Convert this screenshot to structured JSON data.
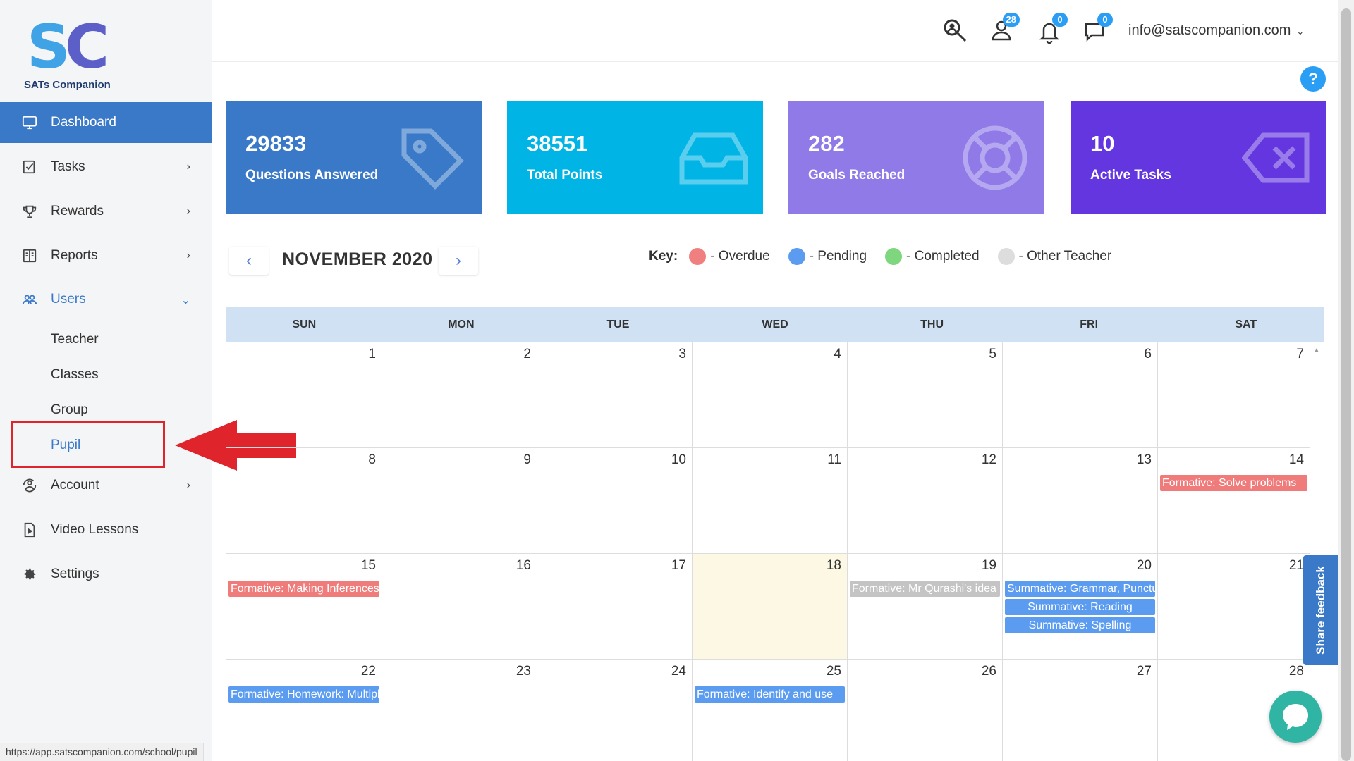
{
  "logo": {
    "mark_s": "S",
    "mark_c": "C",
    "name": "SATs Companion"
  },
  "sidebar": {
    "items": [
      {
        "label": "Dashboard",
        "icon": "monitor-icon"
      },
      {
        "label": "Tasks",
        "icon": "tasks-icon"
      },
      {
        "label": "Rewards",
        "icon": "trophy-icon"
      },
      {
        "label": "Reports",
        "icon": "reports-icon"
      },
      {
        "label": "Users",
        "icon": "users-icon"
      },
      {
        "label": "Account",
        "icon": "account-icon"
      },
      {
        "label": "Video Lessons",
        "icon": "video-icon"
      },
      {
        "label": "Settings",
        "icon": "gear-icon"
      }
    ],
    "users_submenu": [
      "Teacher",
      "Classes",
      "Group",
      "Pupil"
    ]
  },
  "header": {
    "users_badge": "28",
    "notifications_badge": "0",
    "messages_badge": "0",
    "email": "info@satscompanion.com"
  },
  "help": "?",
  "cards": [
    {
      "value": "29833",
      "label": "Questions Answered",
      "color": "#3a79c8",
      "icon": "tag-icon"
    },
    {
      "value": "38551",
      "label": "Total Points",
      "color": "#00b4e6",
      "icon": "inbox-icon"
    },
    {
      "value": "282",
      "label": "Goals Reached",
      "color": "#8f7ae8",
      "icon": "lifebuoy-icon"
    },
    {
      "value": "10",
      "label": "Active Tasks",
      "color": "#6336e0",
      "icon": "backspace-icon"
    }
  ],
  "calendar": {
    "month": "NOVEMBER 2020",
    "prev": "‹",
    "next": "›",
    "legend": {
      "key": "Key:",
      "items": [
        {
          "label": "- Overdue",
          "color": "#f08080"
        },
        {
          "label": "- Pending",
          "color": "#5b9cf0"
        },
        {
          "label": "- Completed",
          "color": "#7ed67e"
        },
        {
          "label": "- Other Teacher",
          "color": "#dddddd"
        }
      ]
    },
    "days": [
      "SUN",
      "MON",
      "TUE",
      "WED",
      "THU",
      "FRI",
      "SAT"
    ],
    "weeks": [
      [
        "1",
        "2",
        "3",
        "4",
        "5",
        "6",
        "7"
      ],
      [
        "8",
        "9",
        "10",
        "11",
        "12",
        "13",
        "14"
      ],
      [
        "15",
        "16",
        "17",
        "18",
        "19",
        "20",
        "21"
      ],
      [
        "22",
        "23",
        "24",
        "25",
        "26",
        "27",
        "28"
      ]
    ],
    "today": "18",
    "events": [
      {
        "day": "14",
        "text": "Formative: Solve problems",
        "color": "#f07b7b"
      },
      {
        "day": "15",
        "text": "Formative: Making Inferences",
        "color": "#f07b7b"
      },
      {
        "day": "19",
        "text": "Formative: Mr Qurashi's idea",
        "color": "#c4c4c4"
      },
      {
        "day": "20",
        "text": "Summative: Grammar, Punctuation",
        "color": "#5b9cf0"
      },
      {
        "day": "20",
        "text": "Summative: Reading",
        "color": "#5b9cf0",
        "center": true
      },
      {
        "day": "20",
        "text": "Summative: Spelling",
        "color": "#5b9cf0",
        "center": true
      },
      {
        "day": "22",
        "text": "Formative: Homework: Multiplication",
        "color": "#5b9cf0"
      },
      {
        "day": "25",
        "text": "Formative: Identify and use",
        "color": "#5b9cf0"
      }
    ]
  },
  "feedback": "Share feedback",
  "status_url": "https://app.satscompanion.com/school/pupil"
}
